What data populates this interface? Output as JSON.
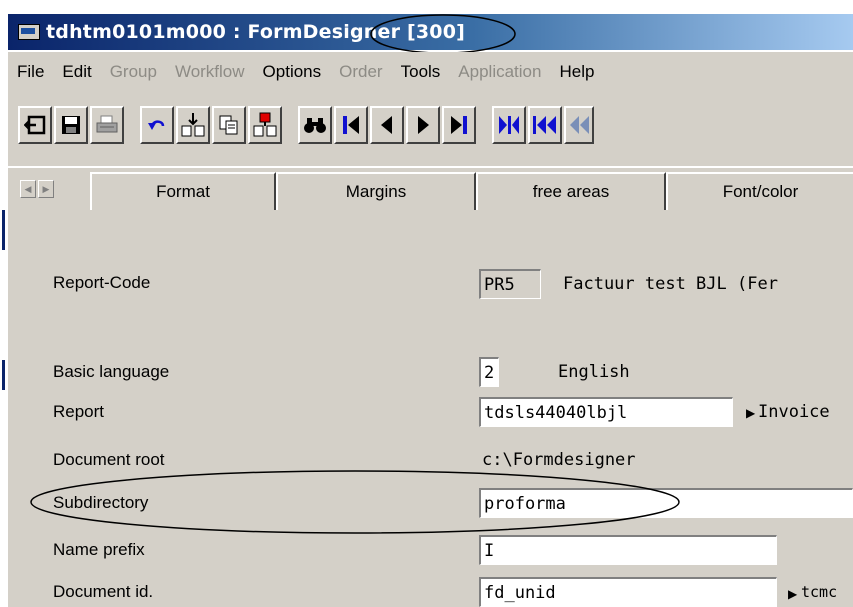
{
  "window": {
    "title": "tdhtm0101m000 : FormDesigner [300]"
  },
  "menu": [
    {
      "label": "File",
      "enabled": true
    },
    {
      "label": "Edit",
      "enabled": true
    },
    {
      "label": "Group",
      "enabled": false
    },
    {
      "label": "Workflow",
      "enabled": false
    },
    {
      "label": "Options",
      "enabled": true
    },
    {
      "label": "Order",
      "enabled": false
    },
    {
      "label": "Tools",
      "enabled": true
    },
    {
      "label": "Application",
      "enabled": false
    },
    {
      "label": "Help",
      "enabled": true
    }
  ],
  "toolbar": [
    "exit-icon",
    "save-icon",
    "print-icon",
    "undo-icon",
    "insert-record-icon",
    "copy-icon",
    "duplicate-record-icon",
    "find-icon",
    "first-record-icon",
    "previous-record-icon",
    "next-record-icon",
    "last-record-icon",
    "first-set-icon",
    "previous-set-icon",
    "rewind-icon"
  ],
  "tabs": [
    "Format",
    "Margins",
    "free areas",
    "Font/color"
  ],
  "form": {
    "report_code": {
      "label": "Report-Code",
      "value": "PR5",
      "description": "Factuur test BJL (Fer"
    },
    "basic_language": {
      "label": "Basic language",
      "value": "2",
      "description": "English"
    },
    "report": {
      "label": "Report",
      "value": "tdsls44040lbjl",
      "description": "Invoice"
    },
    "document_root": {
      "label": "Document root",
      "value": "c:\\Formdesigner"
    },
    "subdirectory": {
      "label": "Subdirectory",
      "value": "proforma"
    },
    "name_prefix": {
      "label": "Name prefix",
      "value": "I"
    },
    "document_id": {
      "label": "Document id.",
      "value": "fd_unid",
      "description": "tcmc"
    }
  },
  "colors": {
    "titlebar_start": "#0a246a",
    "titlebar_end": "#a6caf0",
    "face": "#d4d0c8",
    "disabled_text": "#8d8b85",
    "nav_blue": "#1010d0"
  }
}
